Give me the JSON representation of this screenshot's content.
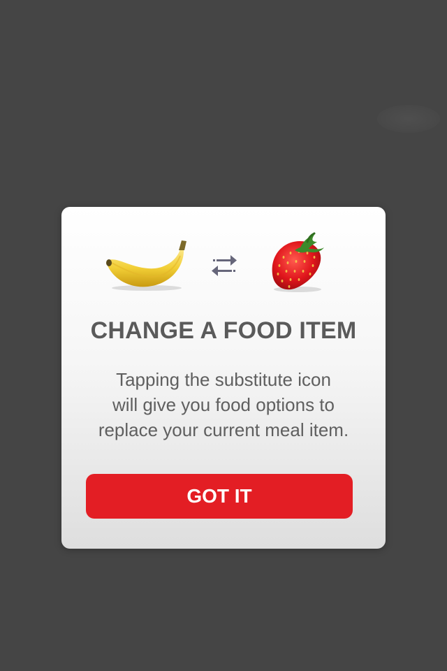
{
  "screen": {
    "background_color": "#454545"
  },
  "modal": {
    "title": "CHANGE  A  FOOD ITEM",
    "description_lines": [
      "Tapping the substitute icon",
      "will give you food options to",
      "replace your current meal item."
    ],
    "button_label": "GOT IT",
    "button_color": "#e31e24",
    "illustration": {
      "left_item_icon": "banana-icon",
      "middle_icon": "swap-icon",
      "right_item_icon": "strawberry-icon"
    }
  }
}
